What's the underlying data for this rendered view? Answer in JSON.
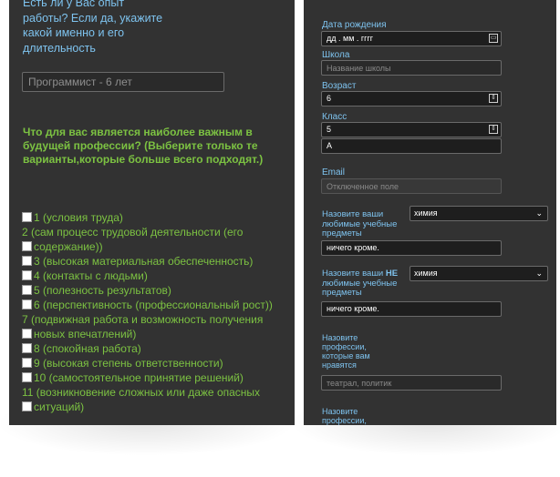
{
  "left": {
    "question_experience": "Есть ли у Вас опыт работы? Если да, укажите какой именно и его длительность",
    "experience_value": "Программист - 6 лет",
    "question_main": "Что для вас является наиболее важным в будущей профессии? (Выберите только те варианты,которые больше всего подходят.)",
    "options": [
      {
        "text": "1 (условия труда)",
        "checkbox": "before"
      },
      {
        "text": "2 (сам процесс трудовой деятельности (его",
        "checkbox": "none"
      },
      {
        "text": "содержание))",
        "checkbox": "before"
      },
      {
        "text": "3 (высокая материальная обеспеченность)",
        "checkbox": "before"
      },
      {
        "text": "4 (контакты с людьми)",
        "checkbox": "before"
      },
      {
        "text": "5 (полезность результатов)",
        "checkbox": "before"
      },
      {
        "text": "6 (перспективность (профессиональный рост))",
        "checkbox": "before"
      },
      {
        "text": "7 (подвижная работа и возможность получения",
        "checkbox": "none"
      },
      {
        "text": "новых впечатлений)",
        "checkbox": "before"
      },
      {
        "text": "8 (спокойная работа)",
        "checkbox": "before"
      },
      {
        "text": "9 (высокая степень ответственности)",
        "checkbox": "before"
      },
      {
        "text": "10 (самостоятельное принятие решений)",
        "checkbox": "before"
      },
      {
        "text": "11 (возникновение сложных или даже опасных",
        "checkbox": "none"
      },
      {
        "text": "ситуаций)",
        "checkbox": "before"
      }
    ]
  },
  "right": {
    "birthdate_label": "Дата рождения",
    "birthdate_value": "дд . мм . гггг",
    "school_label": "Школа",
    "school_placeholder": "Название школы",
    "age_label": "Возраст",
    "age_value": "6",
    "class_label": "Класс",
    "class_value": "5",
    "class_letter_value": "А",
    "email_label": "Email",
    "email_placeholder": "Отключенное поле",
    "liked_subjects_label": "Назовите ваши любимые учебные предметы",
    "liked_subjects_select": "химия",
    "liked_subjects_value": "ничего кроме.",
    "disliked_subjects_label_prefix": "Назовите ваши ",
    "disliked_subjects_label_bold": "НЕ",
    "disliked_subjects_label_suffix": " любимые учебные предметы",
    "disliked_subjects_select": "химия",
    "disliked_subjects_value": "ничего кроме.",
    "liked_professions_label": "Назовите профессии, которые вам нравятся",
    "liked_professions_placeholder": "театрал, политик",
    "professions2_label": "Назовите профессии,"
  }
}
